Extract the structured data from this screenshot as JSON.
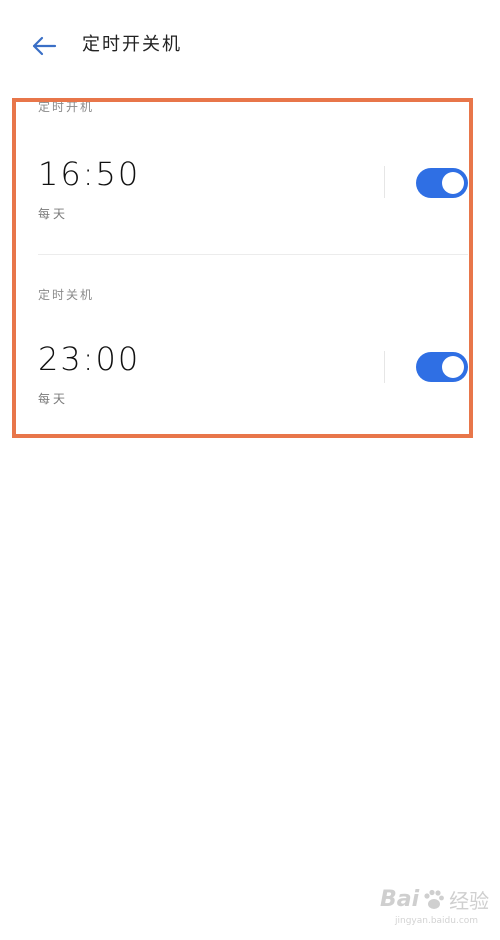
{
  "header": {
    "title": "定时开关机",
    "back_icon": "arrow-left-icon"
  },
  "schedules": [
    {
      "label": "定时开机",
      "time": "16:50",
      "repeat": "每天",
      "enabled": true
    },
    {
      "label": "定时关机",
      "time": "23:00",
      "repeat": "每天",
      "enabled": true
    }
  ],
  "watermark": {
    "brand_left": "Bai",
    "brand_right": "经验",
    "url": "jingyan.baidu.com"
  },
  "colors": {
    "accent": "#2f6fe4",
    "highlight_border": "#e8764a",
    "back_arrow": "#3a6fc6"
  }
}
